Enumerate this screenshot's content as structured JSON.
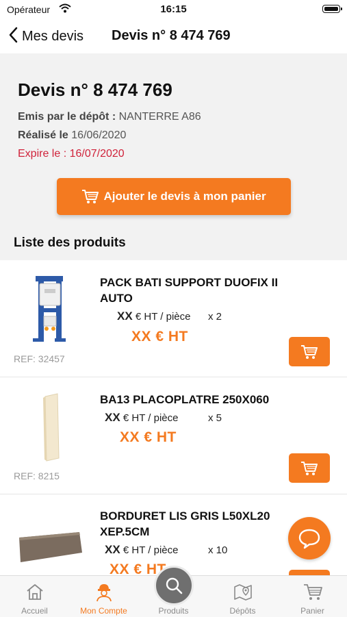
{
  "status_bar": {
    "carrier": "Opérateur",
    "time": "16:15"
  },
  "nav": {
    "back_label": "Mes devis",
    "title": "Devis n° 8 474 769"
  },
  "header": {
    "title": "Devis n° 8 474 769",
    "emis_label": "Emis par le dépôt :",
    "emis_value": "NANTERRE A86",
    "realise_label": "Réalisé le",
    "realise_value": "16/06/2020",
    "expire": "Expire le : 16/07/2020",
    "add_button": "Ajouter le devis à mon panier",
    "list_title": "Liste des produits"
  },
  "products": [
    {
      "name": "PACK BATI SUPPORT DUOFIX II AUTO",
      "price_xx": "XX",
      "price_unit": "€ HT / pièce",
      "qty": "x 2",
      "total": "XX € HT",
      "ref": "REF: 32457",
      "image": "wc-frame-image"
    },
    {
      "name": "BA13 PLACOPLATRE 250X060",
      "price_xx": "XX",
      "price_unit": "€ HT / pièce",
      "qty": "x 5",
      "total": "XX € HT",
      "ref": "REF: 8215",
      "image": "plasterboard-image"
    },
    {
      "name": "BORDURET LIS GRIS L50XL20 XEP.5CM",
      "price_xx": "XX",
      "price_unit": "€ HT / pièce",
      "qty": "x 10",
      "total": "XX € HT",
      "ref": "",
      "image": "border-stone-image"
    }
  ],
  "tabs": [
    {
      "label": "Accueil",
      "icon": "home-icon",
      "active": false
    },
    {
      "label": "Mon Compte",
      "icon": "worker-icon",
      "active": true
    },
    {
      "label": "Produits",
      "icon": "search-icon",
      "active": false
    },
    {
      "label": "Dépôts",
      "icon": "map-icon",
      "active": false
    },
    {
      "label": "Panier",
      "icon": "cart-icon",
      "active": false
    }
  ],
  "colors": {
    "accent": "#f47a20",
    "expire": "#d0223a",
    "header_bg": "#f2f2f2"
  }
}
